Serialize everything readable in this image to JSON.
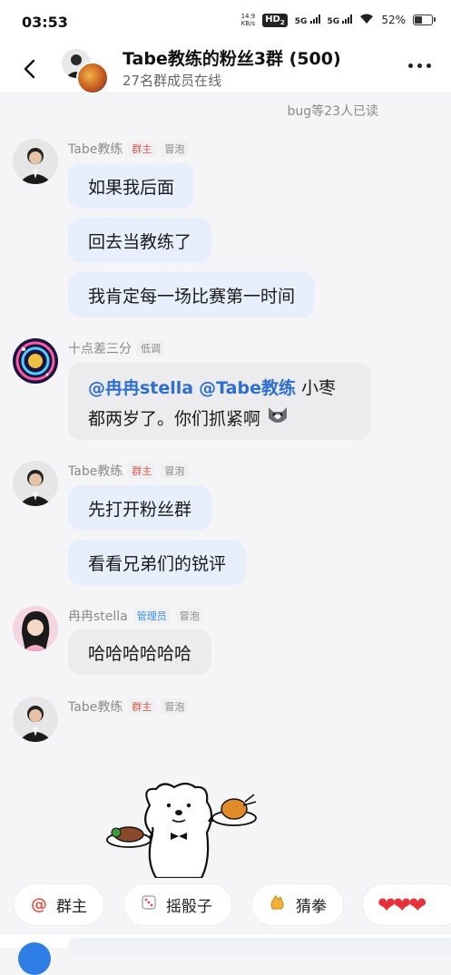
{
  "status_bar": {
    "time": "03:53",
    "net_speed_value": "14.9",
    "net_speed_unit": "KB/s",
    "hd_label": "HD",
    "hd_sub": "2",
    "sig1": "5G",
    "sig2": "5G",
    "battery_pct": "52%",
    "battery_level": 0.52
  },
  "header": {
    "title": "Tabe教练的粉丝3群 (500)",
    "subtitle": "27名群成员在线"
  },
  "read_receipt": "bug等23人已读",
  "messages": [
    {
      "sender": "Tabe教练",
      "tags": [
        "群主",
        "冒泡"
      ],
      "bubbles": [
        "如果我后面",
        "回去当教练了",
        "我肯定每一场比赛第一时间"
      ]
    },
    {
      "sender": "十点差三分",
      "tags": [
        "低调"
      ],
      "mention1": "@冉冉stella",
      "mention2": "@Tabe教练",
      "text_after": " 小枣",
      "line2": "都两岁了。你们抓紧啊"
    },
    {
      "sender": "Tabe教练",
      "tags": [
        "群主",
        "冒泡"
      ],
      "bubbles": [
        "先打开粉丝群",
        "看看兄弟们的锐评"
      ]
    },
    {
      "sender": "冉冉stella",
      "tags": [
        "管理员",
        "冒泡"
      ],
      "bubbles": [
        "哈哈哈哈哈哈"
      ]
    },
    {
      "sender": "Tabe教练",
      "tags": [
        "群主",
        "冒泡"
      ],
      "sticker": "bear-waiter-sticker"
    }
  ],
  "quick_replies": [
    {
      "icon": "@",
      "label": "群主"
    },
    {
      "icon": "dice-icon",
      "label": "摇骰子"
    },
    {
      "icon": "hand-icon",
      "label": "猜拳"
    },
    {
      "icon": "hearts-icon",
      "label": ""
    }
  ],
  "colors": {
    "bubble_blue": "#e8effc",
    "mention": "#2e6fce",
    "owner_tag": "#e0574d",
    "admin_tag": "#3a8ee6"
  }
}
